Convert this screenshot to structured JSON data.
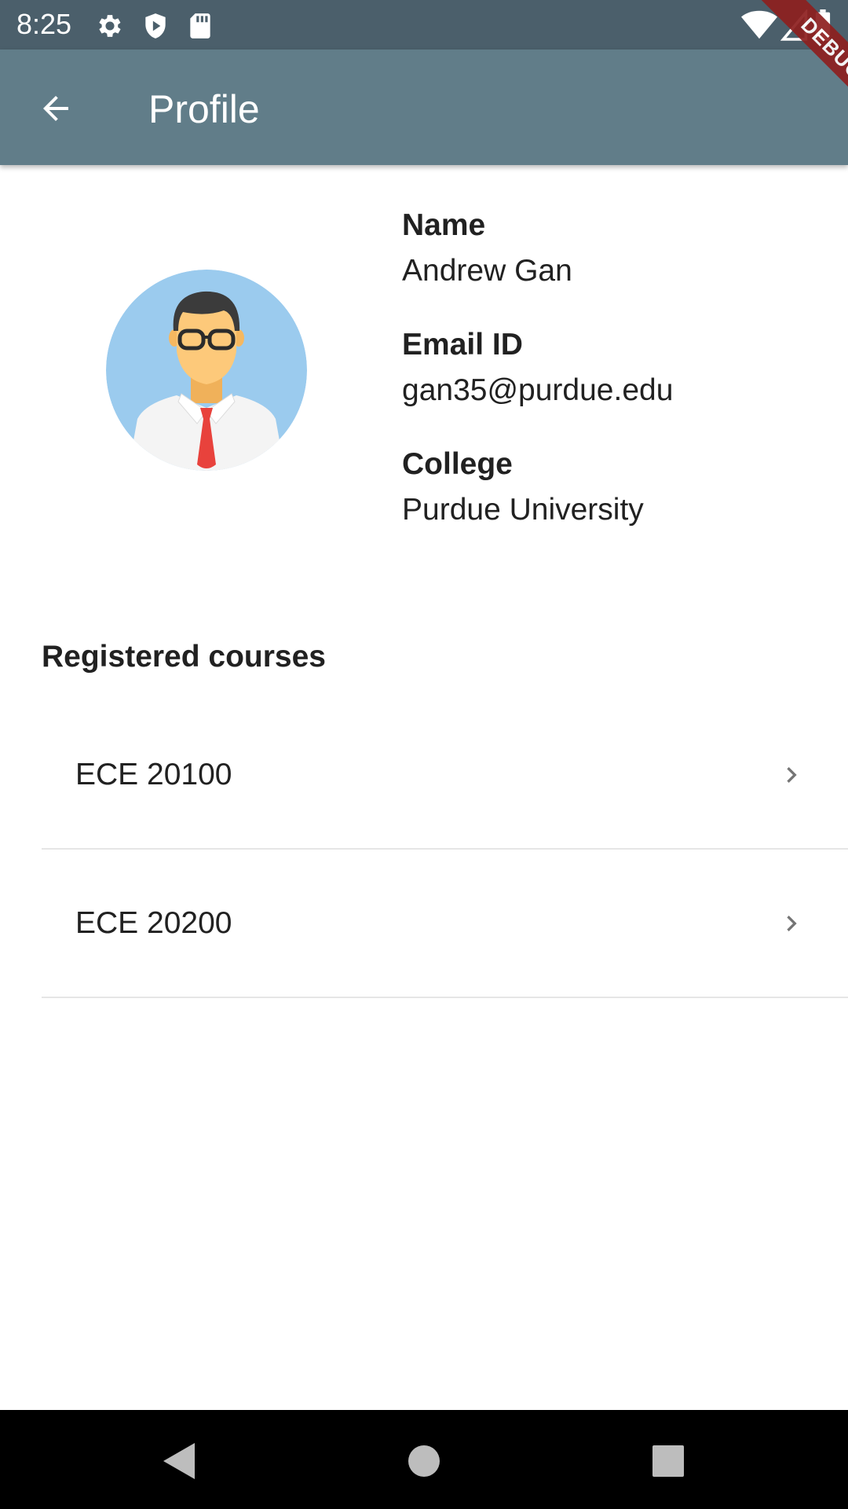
{
  "status_bar": {
    "time": "8:25",
    "icons": [
      "gear-icon",
      "shield-play-icon",
      "sd-card-icon",
      "wifi-icon",
      "signal-icon",
      "battery-icon"
    ]
  },
  "app_bar": {
    "title": "Profile",
    "back_icon": "arrow-back-icon",
    "background": "#617d89"
  },
  "debug_banner": {
    "label": "DEBUG"
  },
  "profile": {
    "fields": [
      {
        "label": "Name",
        "value": "Andrew Gan"
      },
      {
        "label": "Email ID",
        "value": "gan35@purdue.edu"
      },
      {
        "label": "College",
        "value": "Purdue University"
      }
    ]
  },
  "courses": {
    "title": "Registered courses",
    "items": [
      {
        "label": "ECE 20100",
        "icon": "chevron-right-icon"
      },
      {
        "label": "ECE 20200",
        "icon": "chevron-right-icon"
      }
    ]
  },
  "nav_bar": {
    "buttons": [
      "back-triangle-icon",
      "home-circle-icon",
      "recents-square-icon"
    ]
  }
}
